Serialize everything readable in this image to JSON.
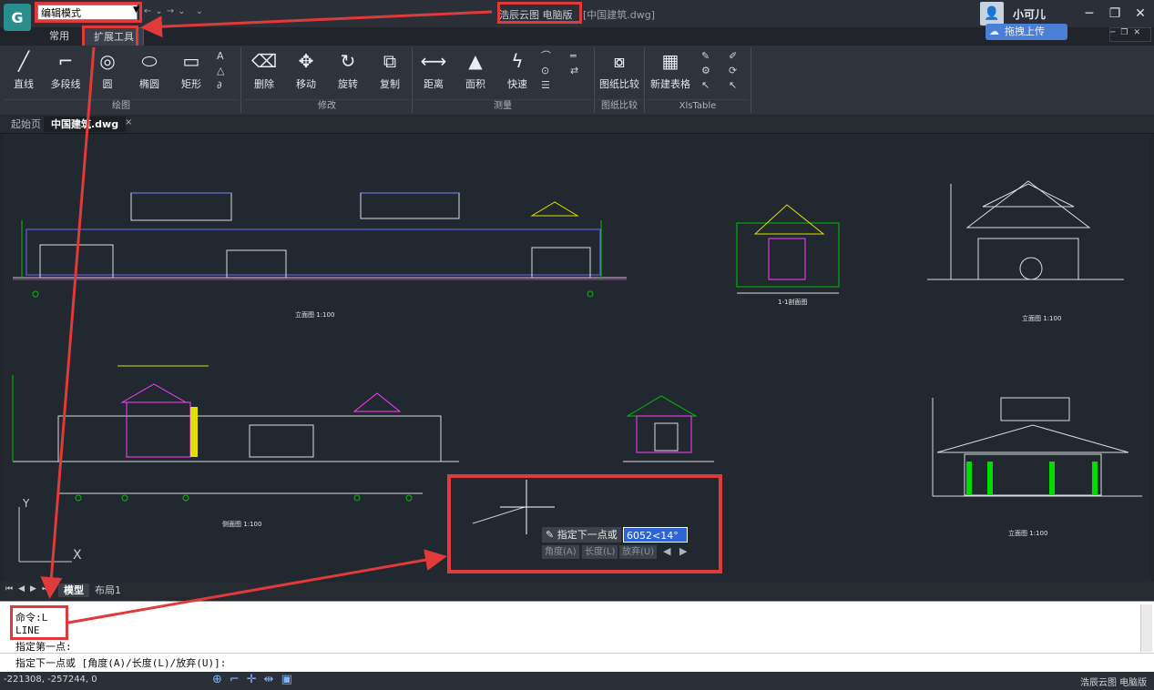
{
  "titlebar": {
    "mode_select": "编辑模式",
    "app_title": "浩辰云图 电脑版",
    "file_title": "[中国建筑.dwg]",
    "username": "小可儿",
    "upload_label": "拖拽上传",
    "min_icon": "─",
    "restore_icon": "❐",
    "close_icon": "✕"
  },
  "ribbon_tabs": [
    "常用",
    "扩展工具"
  ],
  "ribbon": {
    "tools": {
      "line": "直线",
      "polyline": "多段线",
      "circle": "圆",
      "ellipse": "椭圆",
      "rect": "矩形",
      "delete": "删除",
      "move": "移动",
      "rotate": "旋转",
      "copy": "复制",
      "distance": "距离",
      "area": "面积",
      "quick": "快速",
      "compare": "图纸比较",
      "new_table": "新建表格"
    },
    "groups": {
      "draw": "绘图",
      "modify": "修改",
      "measure": "测量",
      "compare": "图纸比较",
      "xls": "XlsTable"
    }
  },
  "doc_tabs": [
    "起始页",
    "中国建筑.dwg"
  ],
  "drawing_labels": {
    "elev1": "立面图",
    "elev1_scale": "1:100",
    "elev2": "立面图",
    "elev2_scale": "1:100",
    "side": "侧面图",
    "side_scale": "1:100",
    "elev3": "立面图",
    "elev3_scale": "1:100",
    "section": "1-1剖面图"
  },
  "ucs": {
    "x": "X",
    "y": "Y"
  },
  "prompt": {
    "label": "指定下一点或",
    "value": "6052<14°",
    "opt_angle": "角度(A)",
    "opt_length": "长度(L)",
    "opt_undo": "放弃(U)"
  },
  "layout_tabs": [
    "模型",
    "布局1"
  ],
  "command": {
    "line1": "命令:L",
    "line2": "LINE",
    "line3": "指定第一点:",
    "line4": "指定下一点或 [角度(A)/长度(L)/放弃(U)]:"
  },
  "status": {
    "coords": "-221308, -257244, 0",
    "brand": "浩辰云图 电脑版"
  },
  "colors": {
    "annotation_red": "#e03a3a",
    "canvas_bg": "#212830",
    "accent_blue": "#4a7fd6"
  }
}
